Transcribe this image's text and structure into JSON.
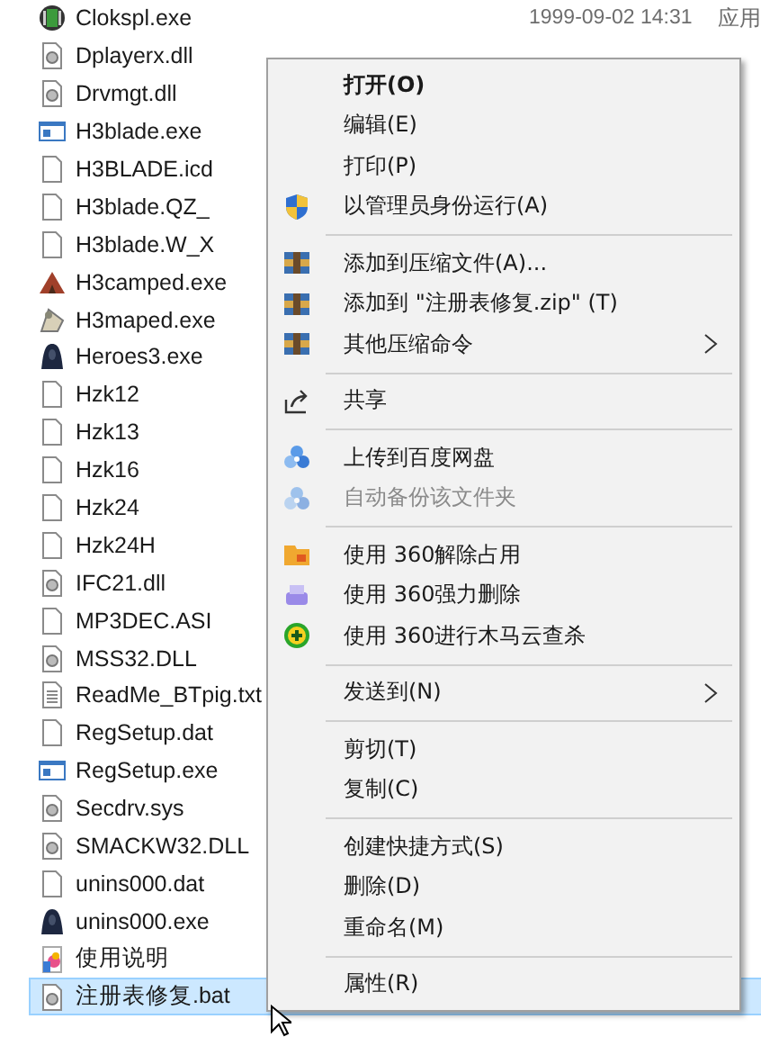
{
  "files": [
    {
      "name": "Clokspl.exe",
      "kind": "app",
      "date": "1999-09-02 14:31",
      "type": "应用",
      "selected": false
    },
    {
      "name": "Dplayerx.dll",
      "kind": "dll",
      "selected": false
    },
    {
      "name": "Drvmgt.dll",
      "kind": "dll",
      "selected": false
    },
    {
      "name": "H3blade.exe",
      "kind": "window",
      "selected": false
    },
    {
      "name": "H3BLADE.icd",
      "kind": "blank",
      "selected": false
    },
    {
      "name": "H3blade.QZ_",
      "kind": "blank",
      "selected": false
    },
    {
      "name": "H3blade.W_X",
      "kind": "blank",
      "selected": false
    },
    {
      "name": "H3camped.exe",
      "kind": "camped",
      "selected": false
    },
    {
      "name": "H3maped.exe",
      "kind": "maped",
      "selected": false
    },
    {
      "name": "Heroes3.exe",
      "kind": "hero",
      "selected": false
    },
    {
      "name": "Hzk12",
      "kind": "blank",
      "selected": false
    },
    {
      "name": "Hzk13",
      "kind": "blank",
      "selected": false
    },
    {
      "name": "Hzk16",
      "kind": "blank",
      "selected": false
    },
    {
      "name": "Hzk24",
      "kind": "blank",
      "selected": false
    },
    {
      "name": "Hzk24H",
      "kind": "blank",
      "selected": false
    },
    {
      "name": "IFC21.dll",
      "kind": "dll",
      "selected": false
    },
    {
      "name": "MP3DEC.ASI",
      "kind": "blank",
      "selected": false
    },
    {
      "name": "MSS32.DLL",
      "kind": "dll",
      "selected": false
    },
    {
      "name": "ReadMe_BTpig.txt",
      "kind": "text",
      "selected": false
    },
    {
      "name": "RegSetup.dat",
      "kind": "blank",
      "selected": false
    },
    {
      "name": "RegSetup.exe",
      "kind": "window",
      "selected": false
    },
    {
      "name": "Secdrv.sys",
      "kind": "dll",
      "selected": false
    },
    {
      "name": "SMACKW32.DLL",
      "kind": "dll",
      "selected": false
    },
    {
      "name": "unins000.dat",
      "kind": "blank",
      "selected": false
    },
    {
      "name": "unins000.exe",
      "kind": "hero",
      "selected": false
    },
    {
      "name": "使用说明",
      "kind": "doc",
      "selected": false
    },
    {
      "name": "注册表修复.bat",
      "kind": "dll",
      "selected": true
    }
  ],
  "context_menu": [
    {
      "kind": "plain",
      "label": "打开(O)",
      "bold": true,
      "disabled": false,
      "submenu": false
    },
    {
      "kind": "plain",
      "label": "编辑(E)",
      "bold": false,
      "disabled": false,
      "submenu": false
    },
    {
      "kind": "plain",
      "label": "打印(P)",
      "bold": false,
      "disabled": false,
      "submenu": false
    },
    {
      "kind": "shield",
      "label": "以管理员身份运行(A)",
      "bold": false,
      "disabled": false,
      "submenu": false
    },
    {
      "kind": "separator"
    },
    {
      "kind": "archive",
      "label": "添加到压缩文件(A)...",
      "bold": false,
      "disabled": false,
      "submenu": false
    },
    {
      "kind": "archive",
      "label": "添加到 \"注册表修复.zip\" (T)",
      "bold": false,
      "disabled": false,
      "submenu": false
    },
    {
      "kind": "archive",
      "label": "其他压缩命令",
      "bold": false,
      "disabled": false,
      "submenu": true
    },
    {
      "kind": "separator"
    },
    {
      "kind": "share",
      "label": "共享",
      "bold": false,
      "disabled": false,
      "submenu": false
    },
    {
      "kind": "separator"
    },
    {
      "kind": "cloud",
      "label": "上传到百度网盘",
      "bold": false,
      "disabled": false,
      "submenu": false
    },
    {
      "kind": "cloud",
      "label": "自动备份该文件夹",
      "bold": false,
      "disabled": true,
      "submenu": false
    },
    {
      "kind": "separator"
    },
    {
      "kind": "folder",
      "label": "使用 360解除占用",
      "bold": false,
      "disabled": false,
      "submenu": false
    },
    {
      "kind": "shredder",
      "label": "使用 360强力删除",
      "bold": false,
      "disabled": false,
      "submenu": false
    },
    {
      "kind": "plus",
      "label": "使用 360进行木马云查杀",
      "bold": false,
      "disabled": false,
      "submenu": false
    },
    {
      "kind": "separator"
    },
    {
      "kind": "plain",
      "label": "发送到(N)",
      "bold": false,
      "disabled": false,
      "submenu": true
    },
    {
      "kind": "separator"
    },
    {
      "kind": "plain",
      "label": "剪切(T)",
      "bold": false,
      "disabled": false,
      "submenu": false
    },
    {
      "kind": "plain",
      "label": "复制(C)",
      "bold": false,
      "disabled": false,
      "submenu": false
    },
    {
      "kind": "separator"
    },
    {
      "kind": "plain",
      "label": "创建快捷方式(S)",
      "bold": false,
      "disabled": false,
      "submenu": false
    },
    {
      "kind": "plain",
      "label": "删除(D)",
      "bold": false,
      "disabled": false,
      "submenu": false
    },
    {
      "kind": "plain",
      "label": "重命名(M)",
      "bold": false,
      "disabled": false,
      "submenu": false
    },
    {
      "kind": "separator"
    },
    {
      "kind": "plain",
      "label": "属性(R)",
      "bold": false,
      "disabled": false,
      "submenu": false
    }
  ]
}
